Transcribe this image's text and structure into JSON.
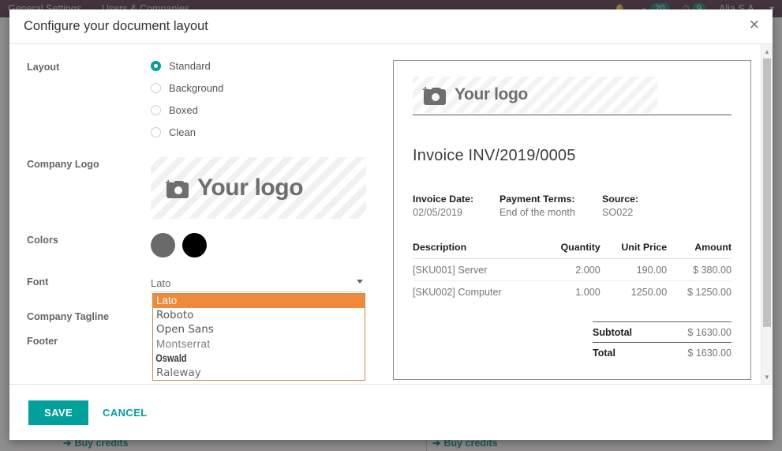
{
  "background": {
    "menu_items": [
      "General Settings",
      "Users & Companies"
    ],
    "bell_icon": "bell-icon",
    "messages_icon": "chat-icon",
    "messages_count": "20",
    "activities_icon": "clock-icon",
    "activities_count": "9",
    "user_name": "Alia S.A.",
    "buy_credits_label": "Buy credits",
    "buy_credits_arrow": "➔"
  },
  "modal": {
    "title": "Configure your document layout",
    "close_label": "✕",
    "save_label": "SAVE",
    "cancel_label": "CANCEL"
  },
  "form": {
    "layout": {
      "label": "Layout",
      "options": [
        {
          "label": "Standard",
          "selected": true
        },
        {
          "label": "Background",
          "selected": false
        },
        {
          "label": "Boxed",
          "selected": false
        },
        {
          "label": "Clean",
          "selected": false
        }
      ]
    },
    "company_logo": {
      "label": "Company Logo",
      "placeholder_text": "Your logo",
      "icon": "camera-add-icon"
    },
    "colors": {
      "label": "Colors",
      "swatches": [
        {
          "name": "primary-color",
          "hex": "#6a6a6a"
        },
        {
          "name": "secondary-color",
          "hex": "#000000"
        }
      ]
    },
    "font": {
      "label": "Font",
      "value": "Lato",
      "options": [
        "Lato",
        "Roboto",
        "Open Sans",
        "Montserrat",
        "Oswald",
        "Raleway"
      ],
      "selected_index": 0
    },
    "company_tagline": {
      "label": "Company Tagline",
      "value": ""
    },
    "footer": {
      "label": "Footer",
      "value": ""
    }
  },
  "preview": {
    "logo_placeholder": "Your logo",
    "logo_icon": "camera-add-icon",
    "invoice_title": "Invoice INV/2019/0005",
    "meta": [
      {
        "label": "Invoice Date:",
        "value": "02/05/2019"
      },
      {
        "label": "Payment Terms:",
        "value": "End of the month"
      },
      {
        "label": "Source:",
        "value": "SO022"
      }
    ],
    "table": {
      "headers": [
        "Description",
        "Quantity",
        "Unit Price",
        "Amount"
      ],
      "rows": [
        {
          "description": "[SKU001] Server",
          "quantity": "2.000",
          "unit_price": "190.00",
          "amount": "$ 380.00"
        },
        {
          "description": "[SKU002] Computer",
          "quantity": "1.000",
          "unit_price": "1250.00",
          "amount": "$ 1250.00"
        }
      ]
    },
    "totals": [
      {
        "label": "Subtotal",
        "value": "$ 1630.00"
      },
      {
        "label": "Total",
        "value": "$ 1630.00"
      }
    ]
  },
  "scrollbar": {
    "up_arrow": "▲",
    "down_arrow": "▼"
  }
}
